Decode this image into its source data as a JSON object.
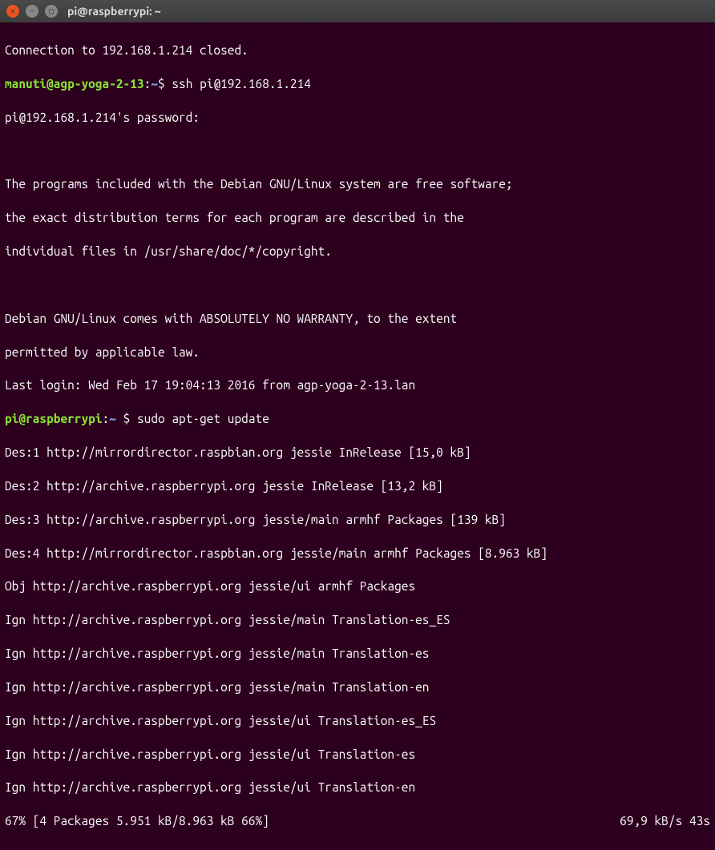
{
  "window": {
    "title": "pi@raspberrypi: ~",
    "close_icon": "✕",
    "min_icon": "–",
    "max_icon": "▢"
  },
  "lines": {
    "conn_closed": "Connection to 192.168.1.214 closed.",
    "prompt1_user": "manuti@agp-yoga-2-13",
    "prompt1_sep": ":",
    "prompt1_path": "~",
    "prompt1_dollar": "$ ",
    "cmd1": "ssh pi@192.168.1.214",
    "pw_prompt": "pi@192.168.1.214's password:",
    "blank": " ",
    "motd1": "The programs included with the Debian GNU/Linux system are free software;",
    "motd2": "the exact distribution terms for each program are described in the",
    "motd3": "individual files in /usr/share/doc/*/copyright.",
    "motd4": "Debian GNU/Linux comes with ABSOLUTELY NO WARRANTY, to the extent",
    "motd5": "permitted by applicable law.",
    "lastlogin": "Last login: Wed Feb 17 19:04:13 2016 from agp-yoga-2-13.lan",
    "prompt2_user": "pi@raspberrypi",
    "prompt2_sep": ":",
    "prompt2_path": "~ ",
    "prompt2_dollar": "$ ",
    "cmd2": "sudo apt-get update",
    "apt1": "Des:1 http://mirrordirector.raspbian.org jessie InRelease [15,0 kB]",
    "apt2": "Des:2 http://archive.raspberrypi.org jessie InRelease [13,2 kB]",
    "apt3": "Des:3 http://archive.raspberrypi.org jessie/main armhf Packages [139 kB]",
    "apt4": "Des:4 http://mirrordirector.raspbian.org jessie/main armhf Packages [8.963 kB]",
    "apt5": "Obj http://archive.raspberrypi.org jessie/ui armhf Packages",
    "apt6": "Ign http://archive.raspberrypi.org jessie/main Translation-es_ES",
    "apt7": "Ign http://archive.raspberrypi.org jessie/main Translation-es",
    "apt8": "Ign http://archive.raspberrypi.org jessie/main Translation-en",
    "apt9": "Ign http://archive.raspberrypi.org jessie/ui Translation-es_ES",
    "apt10": "Ign http://archive.raspberrypi.org jessie/ui Translation-es",
    "apt11": "Ign http://archive.raspberrypi.org jessie/ui Translation-en",
    "status_left": "67% [4 Packages 5.951 kB/8.963 kB 66%]",
    "status_right": "69,9 kB/s 43s"
  }
}
